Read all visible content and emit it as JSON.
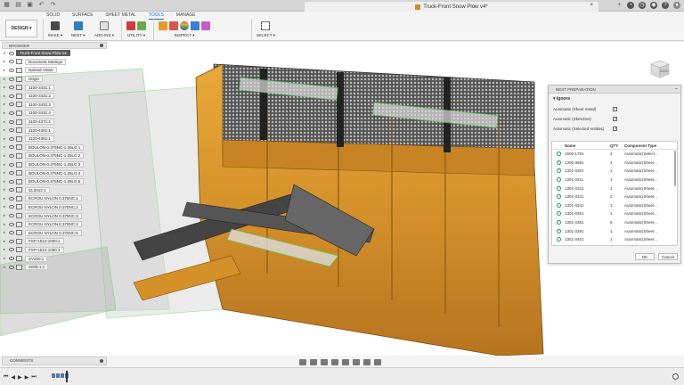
{
  "window": {
    "doc_title": "Truck-Front Snow Plow v4*"
  },
  "toolbar": {
    "tabs": [
      "SOLID",
      "SURFACE",
      "SHEET METAL",
      "TOOLS",
      "MANAGE"
    ],
    "active_tab": "TOOLS",
    "design_label": "DESIGN ▾",
    "groups": {
      "make": "MAKE ▾",
      "nest": "NEST ▾",
      "addins": "ADD-INS ▾",
      "utility": "UTILITY ▾",
      "inspect": "INSPECT ▾",
      "select": "SELECT ▾"
    }
  },
  "browser": {
    "title": "BROWSER",
    "root": "Truck-Front Snow Plow v4",
    "items": [
      "Document Settings",
      "Named Views",
      "Origin",
      "1100-3431:1",
      "1100-3431:2",
      "1100-3431:3",
      "1100-3431:4",
      "1100-4371:1",
      "1100-4391:1",
      "1100-4381:1",
      "BOULON-0.375NC-1.25LG:1",
      "BOULON-0.375NC-1.25LG:2",
      "BOULON-0.375NC-1.25LG:3",
      "BOULON-0.375NC-1.25LG:4",
      "BOULON-0.375NC-1.25LG:5",
      "CL2012:1",
      "ECROU NYLON 0.375NC:1",
      "ECROU NYLON 0.375NC:2",
      "ECROU NYLON 0.375NC:3",
      "ECROU NYLON 0.375NC:4",
      "ECROU NYLON 0.375NC:5",
      "FSP-1512-1000:1",
      "FSP-1512-1000:2",
      "SV250:1",
      "S005-1:1"
    ]
  },
  "nest": {
    "title": "NEST PREPARATION",
    "section": "Ignore",
    "options": [
      {
        "label": "Automatic (Sheet metal)",
        "checked": ""
      },
      {
        "label": "Automatic (Sketches)",
        "checked": "✓"
      },
      {
        "label": "Automatic (Selected entities)",
        "checked": "✓"
      }
    ],
    "columns": {
      "name": "Name",
      "qty": "QTY",
      "type": "Component Type"
    },
    "rows": [
      {
        "name": "1500-1791",
        "qty": "4",
        "type": "Automatic(Select..."
      },
      {
        "name": "1300-3691",
        "qty": "4",
        "type": "Automatic(Sheet..."
      },
      {
        "name": "1301-0301",
        "qty": "1",
        "type": "Automatic(Sheet..."
      },
      {
        "name": "1301-0311",
        "qty": "1",
        "type": "Automatic(Sheet..."
      },
      {
        "name": "1301-0321",
        "qty": "1",
        "type": "Automatic(Sheet..."
      },
      {
        "name": "1301-0331",
        "qty": "2",
        "type": "Automatic(Sheet..."
      },
      {
        "name": "1301-0341",
        "qty": "1",
        "type": "Automatic(Sheet..."
      },
      {
        "name": "1301-0351",
        "qty": "1",
        "type": "Automatic(Sheet..."
      },
      {
        "name": "1301-0381",
        "qty": "6",
        "type": "Automatic(Sheet..."
      },
      {
        "name": "1301-0391",
        "qty": "1",
        "type": "Automatic(Sheet..."
      },
      {
        "name": "1301-0401",
        "qty": "1",
        "type": "Automatic(Sheet..."
      }
    ],
    "ok": "OK",
    "cancel": "Cancel"
  },
  "viewcube": {
    "label": "BACK"
  },
  "comments": {
    "title": "COMMENTS"
  }
}
